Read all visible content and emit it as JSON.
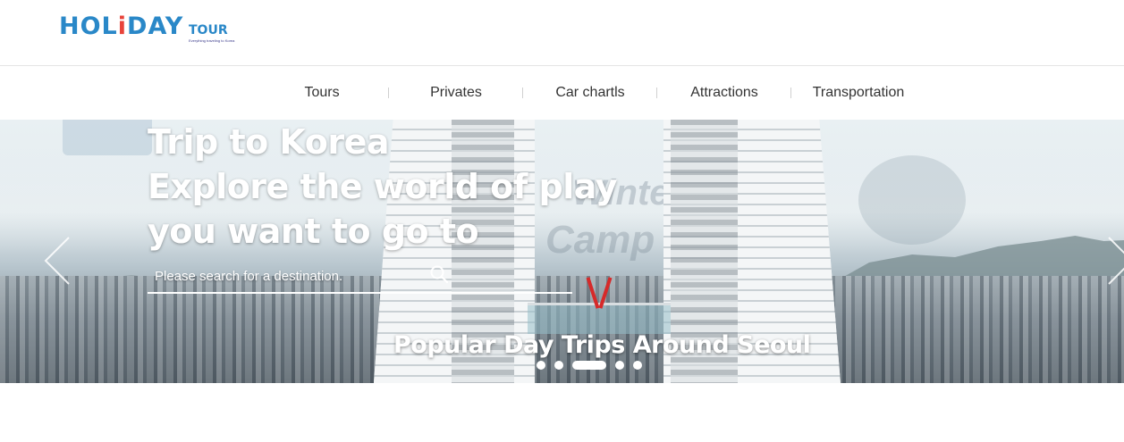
{
  "header": {
    "logo_text": "HOLiDAY",
    "logo_suffix": "TOUR",
    "logo_tagline": "Everything traveling to Korea"
  },
  "nav": {
    "items": [
      {
        "label": "Tours"
      },
      {
        "label": "Privates"
      },
      {
        "label": "Car chartls"
      },
      {
        "label": "Attractions"
      },
      {
        "label": "Transportation"
      }
    ]
  },
  "hero": {
    "title_lines": [
      "Trip to Korea",
      "Explore the world of play",
      "you want to go to"
    ],
    "search": {
      "placeholder": "Please search for a destination.",
      "value": ""
    },
    "caption": "Popular Day Trips Around Seoul",
    "slides_count": 5,
    "active_slide": 3,
    "icons": {
      "prev": "chevron-left-icon",
      "next": "chevron-right-icon",
      "search": "search-icon"
    }
  },
  "colors": {
    "brand_blue": "#2a88c8",
    "brand_red": "#e8433a",
    "nav_text": "#333333",
    "hero_text": "#ffffff"
  }
}
